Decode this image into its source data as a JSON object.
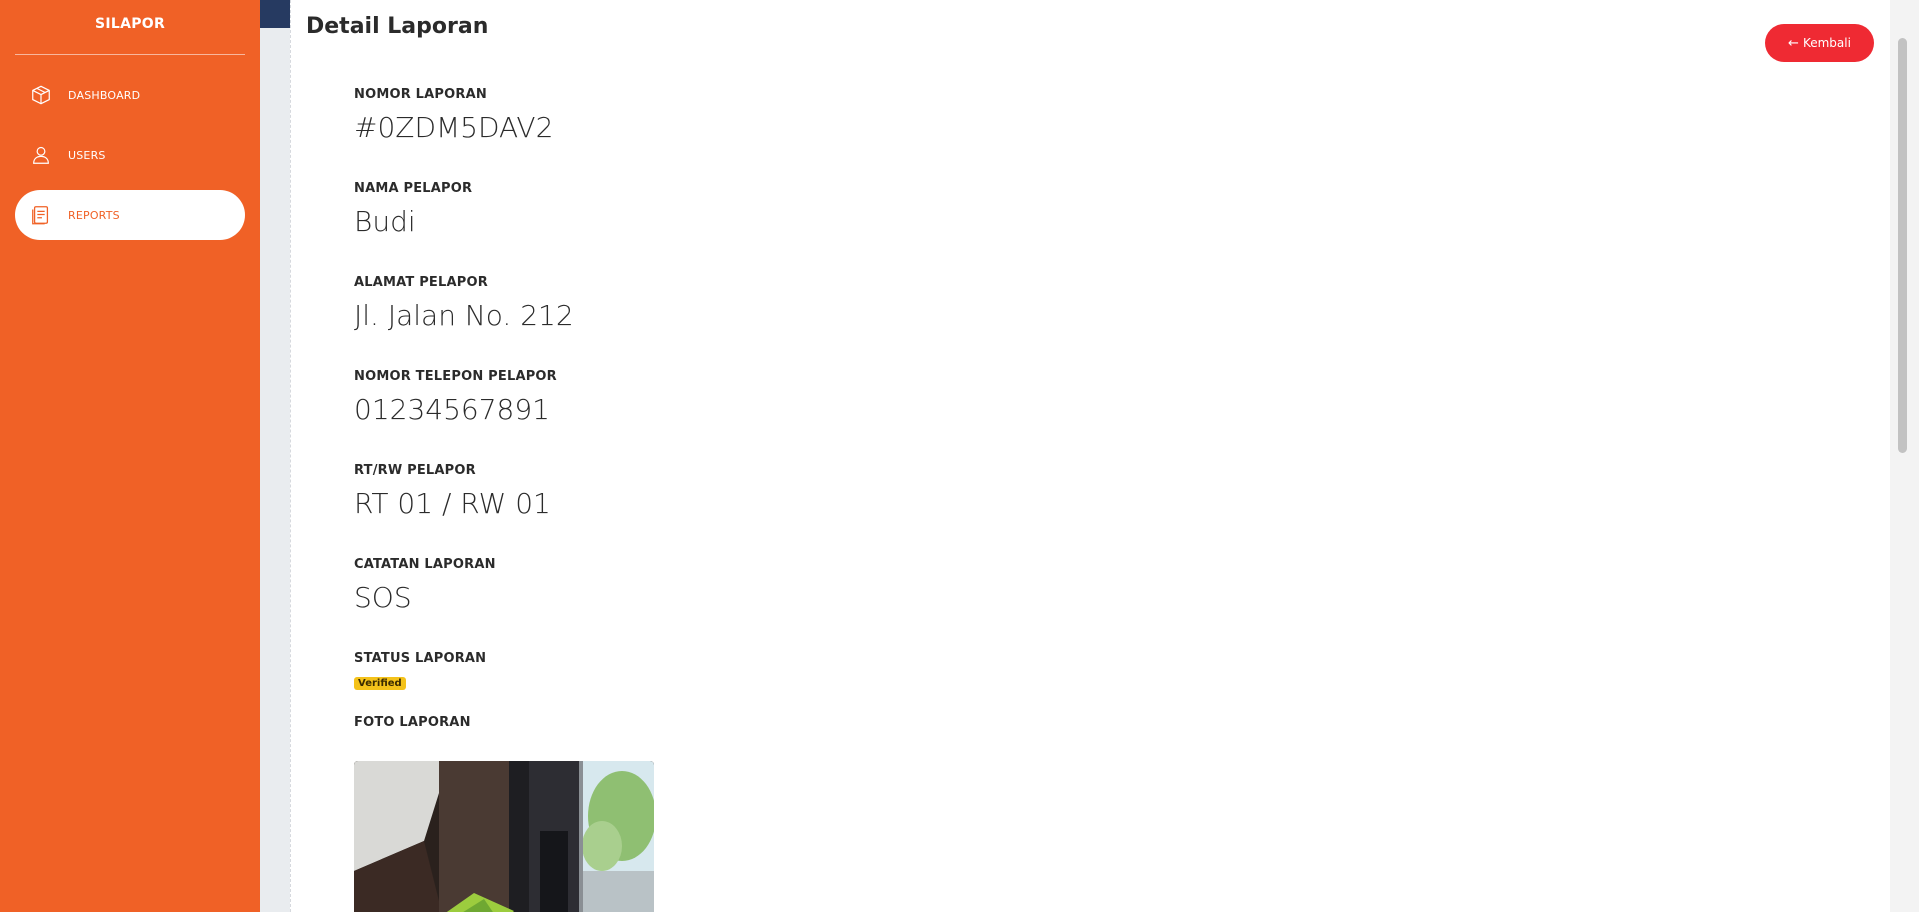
{
  "brand": "SILAPOR",
  "nav": [
    {
      "label": "DASHBOARD",
      "icon": "box-icon",
      "active": false
    },
    {
      "label": "USERS",
      "icon": "user-icon",
      "active": false
    },
    {
      "label": "REPORTS",
      "icon": "report-icon",
      "active": true
    }
  ],
  "page": {
    "title": "Detail Laporan",
    "back_label": "Kembali"
  },
  "fields": [
    {
      "label": "NOMOR LAPORAN",
      "value": "#0ZDM5DAV2"
    },
    {
      "label": "NAMA PELAPOR",
      "value": "Budi"
    },
    {
      "label": "ALAMAT PELAPOR",
      "value": "Jl. Jalan No. 212"
    },
    {
      "label": "NOMOR TELEPON PELAPOR",
      "value": "01234567891"
    },
    {
      "label": "RT/RW PELAPOR",
      "value": "RT 01 / RW 01"
    },
    {
      "label": "CATATAN LAPORAN",
      "value": "SOS"
    }
  ],
  "status": {
    "label": "STATUS LAPORAN",
    "value": "Verified"
  },
  "photo": {
    "label": "FOTO LAPORAN"
  },
  "colors": {
    "sidebar": "#f06126",
    "accent_button": "#ef2a33",
    "badge": "#f4c21a",
    "topband": "#263a61"
  }
}
